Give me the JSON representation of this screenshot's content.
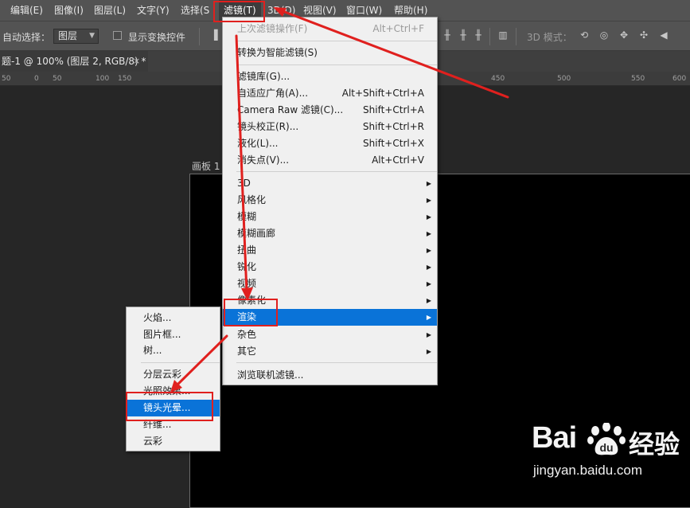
{
  "menubar": {
    "items": [
      "编辑(E)",
      "图像(I)",
      "图层(L)",
      "文字(Y)",
      "选择(S",
      "滤镜(T)",
      "3D(D)",
      "视图(V)",
      "窗口(W)",
      "帮助(H)"
    ]
  },
  "options": {
    "auto_select_label": "自动选择：",
    "layer_select_value": "图层",
    "show_transform_label": "显示变换控件",
    "mode_3d_label": "3D 模式："
  },
  "doc_tab": {
    "title": "题-1 @ 100% (图层 2, RGB/8) *",
    "close": "×"
  },
  "ruler": {
    "ticks": [
      "50",
      "0",
      "50",
      "100",
      "150",
      "",
      "",
      "",
      "",
      "",
      "",
      "",
      "",
      "450",
      "500",
      "550",
      "600"
    ]
  },
  "canvas": {
    "artboard_label": "画板 1"
  },
  "filter_menu": {
    "items": [
      {
        "label": "上次滤镜操作(F)",
        "shortcut": "Alt+Ctrl+F",
        "disabled": true
      },
      {
        "label": "转换为智能滤镜(S)",
        "shortcut": ""
      },
      {
        "label": "滤镜库(G)...",
        "shortcut": ""
      },
      {
        "label": "自适应广角(A)...",
        "shortcut": "Alt+Shift+Ctrl+A"
      },
      {
        "label": "Camera Raw 滤镜(C)...",
        "shortcut": "Shift+Ctrl+A"
      },
      {
        "label": "镜头校正(R)...",
        "shortcut": "Shift+Ctrl+R"
      },
      {
        "label": "液化(L)...",
        "shortcut": "Shift+Ctrl+X"
      },
      {
        "label": "消失点(V)...",
        "shortcut": "Alt+Ctrl+V"
      },
      {
        "label": "3D",
        "submenu": true
      },
      {
        "label": "风格化",
        "submenu": true
      },
      {
        "label": "模糊",
        "submenu": true
      },
      {
        "label": "模糊画廊",
        "submenu": true
      },
      {
        "label": "扭曲",
        "submenu": true
      },
      {
        "label": "锐化",
        "submenu": true
      },
      {
        "label": "视频",
        "submenu": true
      },
      {
        "label": "像素化",
        "submenu": true
      },
      {
        "label": "渲染",
        "submenu": true,
        "highlighted": true
      },
      {
        "label": "杂色",
        "submenu": true
      },
      {
        "label": "其它",
        "submenu": true
      },
      {
        "label": "浏览联机滤镜...",
        "shortcut": ""
      }
    ]
  },
  "render_submenu": {
    "items": [
      {
        "label": "火焰..."
      },
      {
        "label": "图片框..."
      },
      {
        "label": "树..."
      },
      {
        "label": "分层云彩"
      },
      {
        "label": "光照效果..."
      },
      {
        "label": "镜头光晕...",
        "highlighted": true
      },
      {
        "label": "纤维..."
      },
      {
        "label": "云彩"
      }
    ]
  },
  "watermark": {
    "brand": "Bai",
    "brand2": "经验",
    "site": "jingyan.baidu.com"
  },
  "colors": {
    "accent": "#0a73d8",
    "annotation": "#e0201e"
  }
}
